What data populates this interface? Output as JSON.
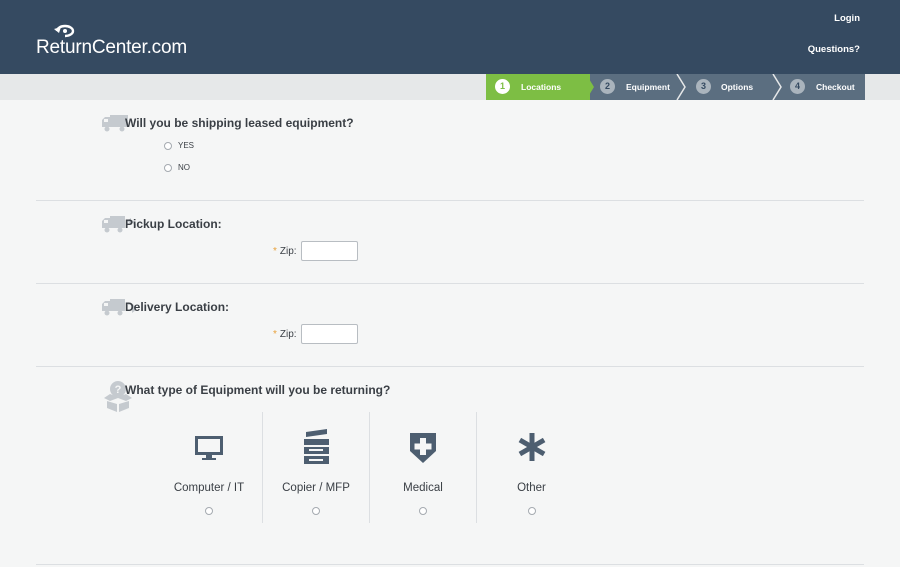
{
  "header": {
    "logo_text": "ReturnCenter.com",
    "login": "Login",
    "questions": "Questions?"
  },
  "steps": [
    {
      "num": "1",
      "label": "Locations",
      "active": true
    },
    {
      "num": "2",
      "label": "Equipment",
      "active": false
    },
    {
      "num": "3",
      "label": "Options",
      "active": false
    },
    {
      "num": "4",
      "label": "Checkout",
      "active": false
    }
  ],
  "leased": {
    "question": "Will you be shipping leased equipment?",
    "options": [
      "YES",
      "NO"
    ]
  },
  "pickup": {
    "title": "Pickup Location:",
    "required_mark": "*",
    "zip_label": "Zip:",
    "zip_value": ""
  },
  "delivery": {
    "title": "Delivery Location:",
    "required_mark": "*",
    "zip_label": "Zip:",
    "zip_value": ""
  },
  "equipment": {
    "question": "What type of Equipment will you be returning?",
    "types": [
      {
        "label": "Computer / IT",
        "icon": "monitor-icon"
      },
      {
        "label": "Copier / MFP",
        "icon": "copier-icon"
      },
      {
        "label": "Medical",
        "icon": "medical-shield-icon"
      },
      {
        "label": "Other",
        "icon": "asterisk-icon"
      }
    ]
  },
  "colors": {
    "header_bg": "#354a61",
    "active_step": "#7dbe44",
    "inactive_step": "#5b6e80",
    "required": "#e8a13b",
    "icon_gray": "#c5cacf",
    "equipment_icon": "#4d5e70"
  }
}
